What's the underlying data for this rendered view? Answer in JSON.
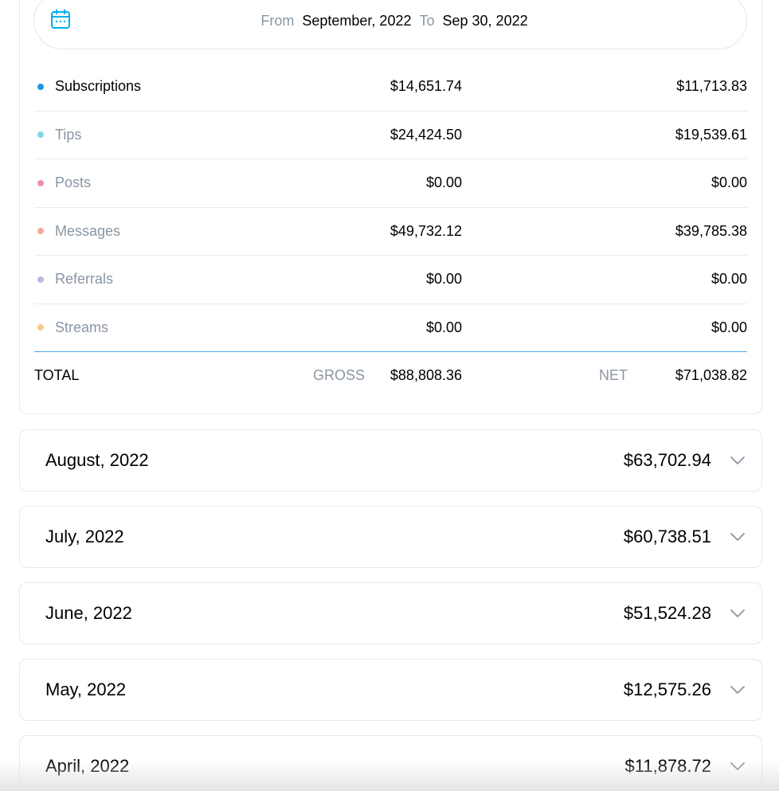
{
  "date_range": {
    "from_label": "From",
    "from_value": "September, 2022",
    "to_label": "To",
    "to_value": "Sep 30, 2022",
    "icon": "calendar-icon"
  },
  "colors": {
    "accent": "#00aff0",
    "subscriptions": "#1c94e0",
    "tips": "#7ed7e6",
    "posts": "#f18fb0",
    "messages": "#f5a899",
    "referrals": "#c9b3e6",
    "streams": "#f8c98d",
    "divider_total": "#4aa8e6"
  },
  "rows": [
    {
      "label": "Subscriptions",
      "gross": "$14,651.74",
      "net": "$11,713.83"
    },
    {
      "label": "Tips",
      "gross": "$24,424.50",
      "net": "$19,539.61"
    },
    {
      "label": "Posts",
      "gross": "$0.00",
      "net": "$0.00"
    },
    {
      "label": "Messages",
      "gross": "$49,732.12",
      "net": "$39,785.38"
    },
    {
      "label": "Referrals",
      "gross": "$0.00",
      "net": "$0.00"
    },
    {
      "label": "Streams",
      "gross": "$0.00",
      "net": "$0.00"
    }
  ],
  "total": {
    "label": "TOTAL",
    "gross_label": "GROSS",
    "gross": "$88,808.36",
    "net_label": "NET",
    "net": "$71,038.82"
  },
  "months": [
    {
      "label": "August, 2022",
      "value": "$63,702.94"
    },
    {
      "label": "July, 2022",
      "value": "$60,738.51"
    },
    {
      "label": "June, 2022",
      "value": "$51,524.28"
    },
    {
      "label": "May, 2022",
      "value": "$12,575.26"
    },
    {
      "label": "April, 2022",
      "value": "$11,878.72"
    }
  ]
}
